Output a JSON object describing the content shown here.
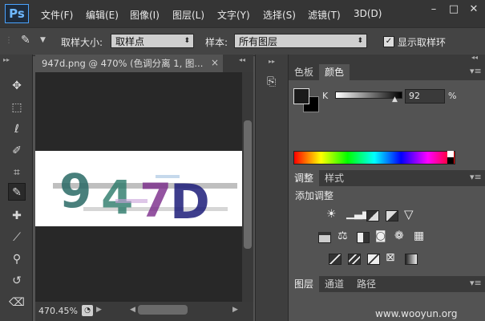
{
  "app": {
    "logo": "Ps"
  },
  "menubar": {
    "items": [
      "文件(F)",
      "编辑(E)",
      "图像(I)",
      "图层(L)",
      "文字(Y)",
      "选择(S)",
      "滤镜(T)",
      "3D(D)"
    ],
    "window_controls": [
      "–",
      "□",
      "✕"
    ]
  },
  "options_bar": {
    "sample_size_label": "取样大小:",
    "sample_size_value": "取样点",
    "sample_label": "样本:",
    "sample_value": "所有图层",
    "show_ring_label": "显示取样环",
    "show_ring_checked": true
  },
  "document": {
    "tab_title": "947d.png @ 470% (色调分离 1, 图...",
    "close": "×",
    "zoom": "470.45%",
    "captcha_text": "947D"
  },
  "color_panel": {
    "tabs": [
      "色板",
      "颜色"
    ],
    "active_tab": "颜色",
    "channel_label": "K",
    "value": "92",
    "unit": "%",
    "k_fraction": 0.92,
    "foreground": "#1a1a1a",
    "background": "#000000"
  },
  "adjust_panel": {
    "tabs": [
      "调整",
      "样式"
    ],
    "active_tab": "调整",
    "add_label": "添加调整"
  },
  "layers_panel": {
    "tabs": [
      "图层",
      "通道",
      "路径"
    ],
    "active_tab": "图层"
  },
  "watermark": "www.wooyun.org"
}
